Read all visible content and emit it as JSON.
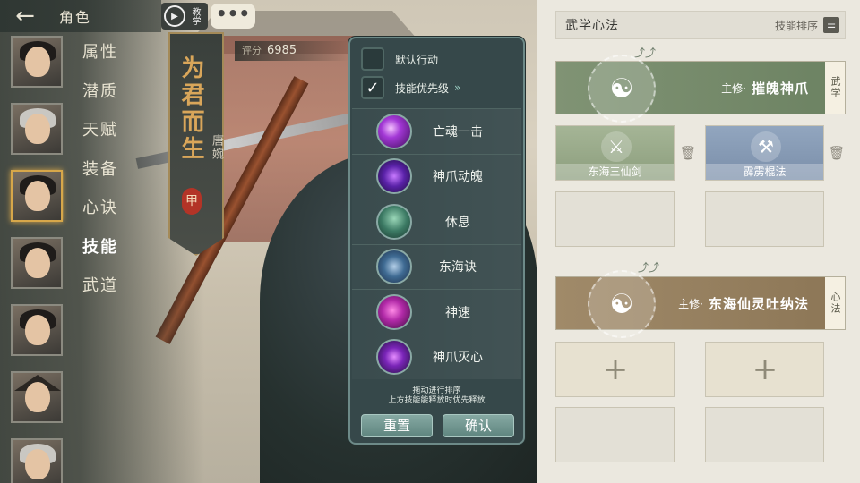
{
  "nav": {
    "title": "角色",
    "tabs": [
      {
        "label": "属性"
      },
      {
        "label": "潜质"
      },
      {
        "label": "天赋"
      },
      {
        "label": "装备"
      },
      {
        "label": "心诀"
      },
      {
        "label": "技能"
      },
      {
        "label": "武道"
      }
    ],
    "active_tab": "技能"
  },
  "teach": {
    "label": "教学"
  },
  "more": {
    "label": "•••"
  },
  "banner": {
    "motto": "为君而生",
    "name": "唐婉",
    "grade": "甲"
  },
  "score": {
    "label": "评分",
    "value": "6985"
  },
  "panel": {
    "default_action": "默认行动",
    "skill_priority": "技能优先级",
    "skills": [
      {
        "name": "亡魂一击",
        "icon": "purple-swirl-icon"
      },
      {
        "name": "神爪动魄",
        "icon": "purple-claw-icon"
      },
      {
        "name": "休息",
        "icon": "meditation-icon"
      },
      {
        "name": "东海诀",
        "icon": "blue-wave-icon"
      },
      {
        "name": "神速",
        "icon": "magenta-speed-icon"
      },
      {
        "name": "神爪灭心",
        "icon": "purple-strike-icon"
      }
    ],
    "hint_line1": "拖动进行排序",
    "hint_line2": "上方技能能释放时优先释放",
    "reset": "重置",
    "confirm": "确认"
  },
  "right": {
    "header_title": "武学心法",
    "sort_label": "技能排序",
    "martial": {
      "main_label": "主修·",
      "main_name": "摧魄神爪",
      "tag": "武学",
      "subs": [
        "东海三仙剑",
        "霹雳棍法"
      ]
    },
    "heart": {
      "main_label": "主修·",
      "main_name": "东海仙灵吐纳法",
      "tag": "心法"
    }
  },
  "colors": {
    "panel_bg": "#36484a",
    "martial_green": "#809374",
    "heart_brown": "#a08a69",
    "banner_gold": "#d9a65a"
  }
}
